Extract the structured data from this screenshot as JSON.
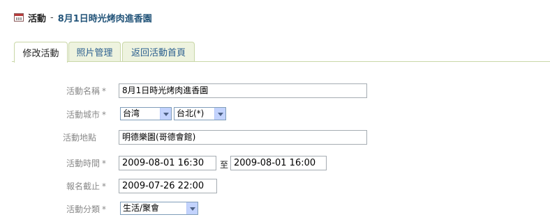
{
  "header": {
    "section": "活動",
    "separator": "-",
    "title": "8月1日時光烤肉進香園"
  },
  "tabs": [
    {
      "label": "修改活動",
      "active": true
    },
    {
      "label": "照片管理",
      "active": false
    },
    {
      "label": "返回活動首頁",
      "active": false
    }
  ],
  "form": {
    "name": {
      "label": "活動名稱",
      "required": "*",
      "value": "8月1日時光烤肉進香園"
    },
    "city": {
      "label": "活動城市",
      "required": "*",
      "country": "台湾",
      "city": "台北(*)"
    },
    "location": {
      "label": "活動地點",
      "value": "明德樂園(哥德會館)"
    },
    "time": {
      "label": "活動時間",
      "required": "*",
      "start": "2009-08-01 16:30",
      "to": "至",
      "end": "2009-08-01 16:00"
    },
    "deadline": {
      "label": "報名截止",
      "required": "*",
      "value": "2009-07-26 22:00"
    },
    "category": {
      "label": "活動分類",
      "required": "*",
      "value": "生活/聚會"
    }
  },
  "colors": {
    "tab_border": "#c9d7a7",
    "tab_inactive_bg": "#eef3df",
    "link": "#2b5f8f",
    "title": "#24557a"
  }
}
